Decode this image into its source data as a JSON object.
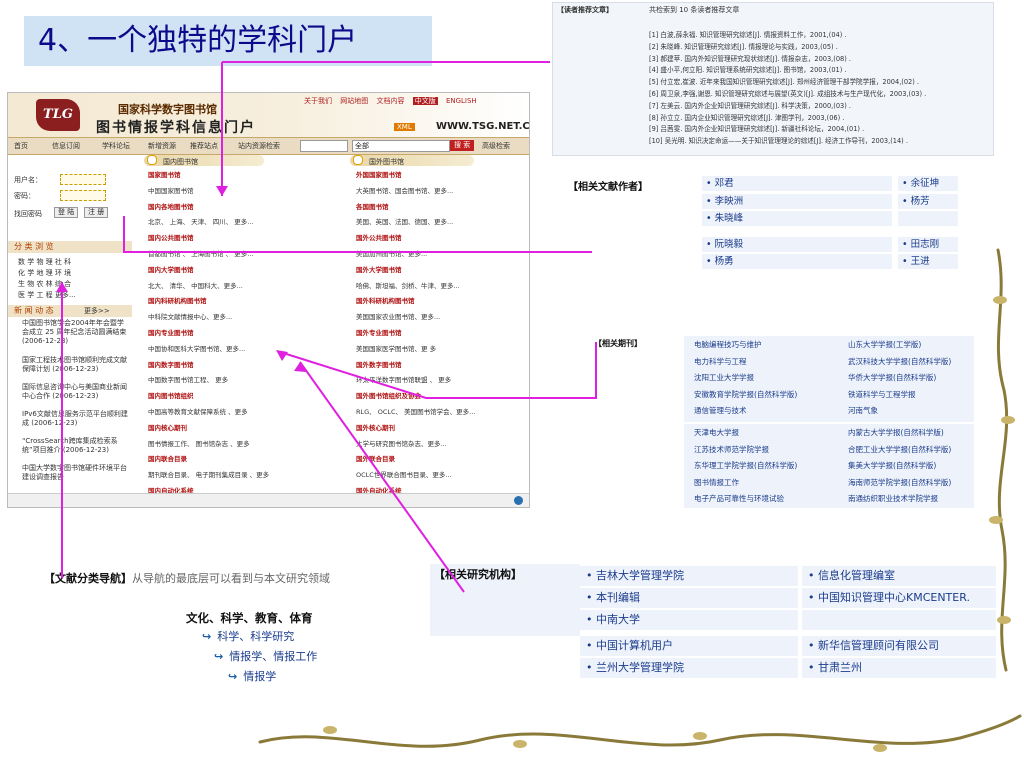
{
  "slide_title": "4、一个独特的学科门户",
  "portal": {
    "logo_text": "TLG",
    "library_name": "国家科学数字图书馆",
    "center_name": "图书情报学科信息门户",
    "top_links": [
      "关于我们",
      "网站地图",
      "文档内容",
      "中文版",
      "ENGLISH"
    ],
    "xml_badge": "XML",
    "url": "WWW.TSG.NET.CN",
    "nav_items": [
      "首页",
      "信息订阅",
      "学科论坛",
      "新增资源",
      "推荐站点",
      "站内资源检索"
    ],
    "select_value": "全部",
    "search_button": "搜 索",
    "advanced_search": "高级检索",
    "login": {
      "username_label": "用户名：",
      "password_label": "密码：",
      "recover_password": "找回密码",
      "login_button": "登 陆",
      "register_button": "注 册"
    },
    "category_header": "分 类 浏 览",
    "subjects": [
      "数 学  物 理  社 科",
      "化 学  地 理  环 境",
      "生 物  农 林  综 合",
      "医 学  工 程  更多..."
    ],
    "news_header": "新 闻 动 态",
    "news_more": "更多>>",
    "news": [
      "中国图书馆学会2004年年会暨学会成立 25 周年纪念活动圆满结束 (2006-12-23)",
      "国家工程技术图书馆顺利完成文献保障计划 (2006-12-23)",
      "国际信息咨询中心与美国商业新闻中心合作 (2006-12-23)",
      "IPv6文献信息服务示范平台顺利建成 (2006-12-23)",
      "“CrossSearch跨库集成检索系统”项目推介 (2006-12-23)",
      "中国大学数字图书馆硬件环境平台建设调查报告"
    ],
    "domestic": {
      "header": "国内图书馆",
      "rows": [
        {
          "kind": "h",
          "text": "国家图书馆"
        },
        {
          "kind": "t",
          "text": "中国国家图书馆"
        },
        {
          "kind": "h",
          "text": "国内各地图书馆"
        },
        {
          "kind": "t",
          "text": "北京、 上海、 天津、 四川、 更多..."
        },
        {
          "kind": "h",
          "text": "国内公共图书馆"
        },
        {
          "kind": "t",
          "text": "首都图书馆 、 上海图书馆 、 更多..."
        },
        {
          "kind": "h",
          "text": "国内大学图书馆"
        },
        {
          "kind": "t",
          "text": "北大、 清华、 中国科大、更多..."
        },
        {
          "kind": "h",
          "text": "国内科研机构图书馆"
        },
        {
          "kind": "t",
          "text": "中科院文献情报中心、更多..."
        },
        {
          "kind": "h",
          "text": "国内专业图书馆"
        },
        {
          "kind": "t",
          "text": "中国协和医科大学图书馆、更多..."
        },
        {
          "kind": "h",
          "text": "国内数字图书馆"
        },
        {
          "kind": "t",
          "text": "中国数字图书馆工程、 更多"
        },
        {
          "kind": "h",
          "text": "国内图书馆组织"
        },
        {
          "kind": "t",
          "text": "中国高等教育文献保障系统 、更多"
        },
        {
          "kind": "h",
          "text": "国内核心期刊"
        },
        {
          "kind": "t",
          "text": "图书情报工作、 图书馆杂志 、更多"
        },
        {
          "kind": "h",
          "text": "国内联合目录"
        },
        {
          "kind": "t",
          "text": "期刊联合目录、 电子期刊集成目录 、更多"
        },
        {
          "kind": "h",
          "text": "国内自动化系统"
        }
      ]
    },
    "foreign": {
      "header": "国外图书馆",
      "rows": [
        {
          "kind": "h",
          "text": "外国国家图书馆"
        },
        {
          "kind": "t",
          "text": "大英图书馆、国会图书馆、更多..."
        },
        {
          "kind": "h",
          "text": "各国图书馆"
        },
        {
          "kind": "t",
          "text": "美国、英国、法国、德国、更多..."
        },
        {
          "kind": "h",
          "text": "国外公共图书馆"
        },
        {
          "kind": "t",
          "text": "美国加州图书馆、更多..."
        },
        {
          "kind": "h",
          "text": "国外大学图书馆"
        },
        {
          "kind": "t",
          "text": "哈佛、斯坦福、剑桥、牛津、更多..."
        },
        {
          "kind": "h",
          "text": "国外科研机构图书馆"
        },
        {
          "kind": "t",
          "text": "美国国家农业图书馆、更多..."
        },
        {
          "kind": "h",
          "text": "国外专业图书馆"
        },
        {
          "kind": "t",
          "text": "美国国家医学图书馆、更 多"
        },
        {
          "kind": "h",
          "text": "国外数字图书馆"
        },
        {
          "kind": "t",
          "text": "环太平洋数字图书馆联盟 、 更多"
        },
        {
          "kind": "h",
          "text": "国外图书馆组织及协会"
        },
        {
          "kind": "t",
          "text": "RLG、 OCLC、 美国图书馆学会、更多..."
        },
        {
          "kind": "h",
          "text": "国外核心期刊"
        },
        {
          "kind": "t",
          "text": "大学与研究图书馆杂志、更多..."
        },
        {
          "kind": "h",
          "text": "国外联合目录"
        },
        {
          "kind": "t",
          "text": "OCLC世界联合图书目录、更多..."
        },
        {
          "kind": "h",
          "text": "国外自动化系统"
        }
      ]
    }
  },
  "recommended": {
    "title": "【读者推荐文章】",
    "count": "共检索到 10 条读者推荐文章",
    "refs": [
      "[1] 白波,薛永福. 知识管理研究综述[J]. 情报资料工作，2001,(04) .",
      "[2] 朱晓峰. 知识管理研究综述[J]. 情报理论与实践，2003,(05) .",
      "[3] 郝建苹. 国内外知识管理研究现状综述[J]. 情报杂志，2003,(08) .",
      "[4] 盛小平,何立阳. 知识管理系统研究综述[J]. 图书馆，2003,(01) .",
      "[5] 付立宏,崔波. 近年来我国知识管理研究综述[J]. 郑州经济管理干部学院学报，2004,(02) .",
      "[6] 周卫泉,李强,谢恩. 知识管理研究综述与展望(英文)[J]. 成组技术与生产现代化，2003,(03) .",
      "[7] 左美云. 国内外企业知识管理研究综述[J]. 科学决策，2000,(03) .",
      "[8] 孙立立. 国内企业知识管理研究综述[J]. 津图学刊，2003,(06) .",
      "[9] 吕茜雯. 国内外企业知识管理研究综述[J]. 新疆社科论坛，2004,(01) .",
      "[10] 吴光明. 知识决定命运——关于知识管理理论的综述[J]. 经济工作导刊，2003,(14) ."
    ]
  },
  "authors": {
    "title": "【相关文献作者】",
    "rows": [
      [
        "• 邓君",
        "• 余征坤"
      ],
      [
        "• 李映洲",
        "• 杨芳"
      ],
      [
        "• 朱晓峰",
        ""
      ],
      [
        "• 阮晓毅",
        "• 田志刚"
      ],
      [
        "• 杨勇",
        "• 王进"
      ]
    ]
  },
  "journals": {
    "title": "【相关期刊】",
    "group1": [
      [
        "电脑编程技巧与维护",
        "山东大学学报(工学版)"
      ],
      [
        "电力科学与工程",
        "武汉科技大学学报(自然科学版)"
      ],
      [
        "沈阳工业大学学报",
        "华侨大学学报(自然科学版)"
      ],
      [
        "安徽教育学院学报(自然科学版)",
        "铁道科学与工程学报"
      ],
      [
        "通信管理与技术",
        "河南气象"
      ]
    ],
    "group2": [
      [
        "天津电大学报",
        "内蒙古大学学报(自然科学版)"
      ],
      [
        "江苏技术师范学院学报",
        "合肥工业大学学报(自然科学版)"
      ],
      [
        "东华理工学院学报(自然科学版)",
        "集美大学学报(自然科学版)"
      ],
      [
        "图书情报工作",
        "海南师范学院学报(自然科学版)"
      ],
      [
        "电子产品可靠性与环境试验",
        "南通纺织职业技术学院学报"
      ]
    ]
  },
  "classification": {
    "title": "【文献分类导航】",
    "desc": "从导航的最底层可以看到与本文研究领域",
    "path": "文化、科学、教育、体育",
    "items": [
      "科学、科学研究",
      "情报学、情报工作",
      "情报学"
    ]
  },
  "institutions": {
    "title": "【相关研究机构】",
    "rows": [
      [
        "• 吉林大学管理学院",
        "• 信息化管理编室"
      ],
      [
        "• 本刊编辑",
        "• 中国知识管理中心KMCENTER."
      ],
      [
        "• 中南大学",
        ""
      ],
      [
        "• 中国计算机用户",
        "• 新华信管理顾问有限公司"
      ],
      [
        "• 兰州大学管理学院",
        "• 甘肃兰州"
      ]
    ]
  },
  "colors": {
    "title_bg": "#cfe3f4",
    "title_text": "#0a0a8a",
    "connector": "#e020e0",
    "link_blue": "#1a3c8c",
    "portal_red": "#b01010"
  }
}
